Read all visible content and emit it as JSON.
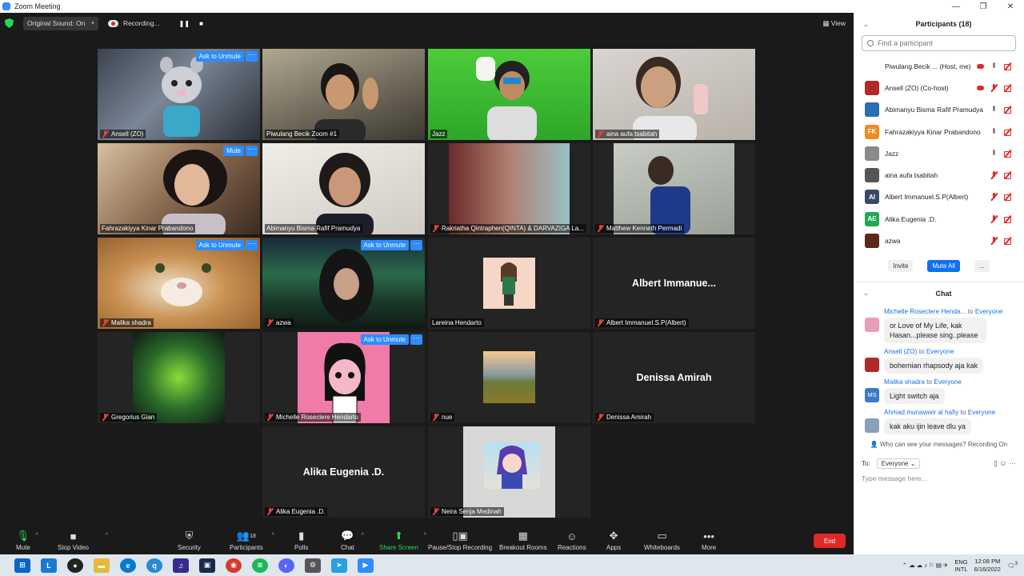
{
  "window": {
    "title": "Zoom Meeting",
    "controls": [
      "—",
      "❐",
      "✕"
    ]
  },
  "topbar": {
    "audio_label": "Original Sound: On",
    "recording_label": "Recording...",
    "pause_glyph": "❚❚",
    "stop_glyph": "■",
    "view_label": "View"
  },
  "tiles": [
    {
      "name": "Ansell (ZO)",
      "muted": true,
      "badge": "Ask to Unmute",
      "more": "···"
    },
    {
      "name": "Piwulang Becik Zoom #1",
      "muted": false,
      "active": true
    },
    {
      "name": "Jazz",
      "muted": false
    },
    {
      "name": "aina aufa tsabitah",
      "muted": true
    },
    {
      "name": "Fahrazakiyya Kinar Prabandono",
      "muted": false,
      "badge": "Mute",
      "more": "···"
    },
    {
      "name": "Abimanyu Bisma Rafif Pramudya",
      "muted": false
    },
    {
      "name": "Rakriatha Qintraphen(QINTA) & DARVAZIGA La...",
      "muted": true
    },
    {
      "name": "Matthew Kenneth Permadi",
      "muted": true
    },
    {
      "name": "Malika shadra",
      "muted": true,
      "badge": "Ask to Unmute",
      "more": "···"
    },
    {
      "name": "azwa",
      "muted": true,
      "badge": "Ask to Unmute",
      "more": "···"
    },
    {
      "name": "Lareina Hendarto",
      "muted": false
    },
    {
      "name": "Albert Immanuel.S.P(Albert)",
      "muted": true,
      "big": "Albert  Immanue..."
    },
    {
      "name": "Gregorius Gian",
      "muted": true
    },
    {
      "name": "Michelle Roseclere Hendarto",
      "muted": true,
      "badge": "Ask to Unmute",
      "more": "···"
    },
    {
      "name": "nue",
      "muted": true
    },
    {
      "name": "Denissa Amirah",
      "muted": true,
      "big": "Denissa Amirah"
    },
    {
      "name": "Alika Eugenia .D.",
      "muted": true,
      "big": "Alika Eugenia .D."
    },
    {
      "name": "Neira Senja Medinah",
      "muted": true
    }
  ],
  "toolbar": {
    "mute": "Mute",
    "stop_video": "Stop Video",
    "security": "Security",
    "participants": "Participants",
    "participants_count": "18",
    "polls": "Polls",
    "chat": "Chat",
    "share_screen": "Share Screen",
    "pause_recording": "Pause/Stop Recording",
    "breakout_rooms": "Breakout Rooms",
    "reactions": "Reactions",
    "apps": "Apps",
    "whiteboards": "Whiteboards",
    "more": "More",
    "end": "End"
  },
  "participants_panel": {
    "title": "Participants (18)",
    "search_placeholder": "Find a participant",
    "items": [
      {
        "name": "Piwulang Becik ...   (Host, me)",
        "avatar_color": "#ffffff",
        "initials": "",
        "icons": [
          "rec",
          "mic",
          "cam"
        ]
      },
      {
        "name": "Ansell (ZO) (Co-host)",
        "avatar_color": "#b02a2a",
        "initials": "",
        "icons": [
          "rec",
          "micx",
          "cam"
        ]
      },
      {
        "name": "Abimanyu Bisma Rafif Pramudya",
        "avatar_color": "#2a6fb0",
        "initials": "",
        "icons": [
          "mic",
          "cam"
        ]
      },
      {
        "name": "Fahrazakiyya Kinar Prabandono",
        "avatar_color": "#f08a24",
        "initials": "FK",
        "icons": [
          "mic",
          "cam"
        ]
      },
      {
        "name": "Jazz",
        "avatar_color": "#8a8a8a",
        "initials": "",
        "icons": [
          "mic",
          "cam"
        ]
      },
      {
        "name": "aina aufa tsabitah",
        "avatar_color": "#555555",
        "initials": "",
        "icons": [
          "micx",
          "cam"
        ]
      },
      {
        "name": "Albert Immanuel.S.P(Albert)",
        "avatar_color": "#3a4a66",
        "initials": "AI",
        "icons": [
          "micx",
          "cam"
        ]
      },
      {
        "name": "Alika Eugenia .D.",
        "avatar_color": "#23a85a",
        "initials": "AE",
        "icons": [
          "micx",
          "cam"
        ]
      },
      {
        "name": "azwa",
        "avatar_color": "#5a2a1a",
        "initials": "",
        "icons": [
          "micx",
          "cam"
        ]
      }
    ],
    "invite": "Invite",
    "mute_all": "Mute All",
    "more": "..."
  },
  "chat": {
    "title": "Chat",
    "messages": [
      {
        "from": "Michelle Roseclere Henda...",
        "to_word": "to",
        "to": "Everyone",
        "text": "or Love of My Life, kak Hasan...please sing..please",
        "avatar_color": "#e8a0b8",
        "initials": ""
      },
      {
        "from": "Ansell (ZO)",
        "to_word": "to",
        "to": "Everyone",
        "text": "bohemian rhapsody aja kak",
        "avatar_color": "#b02a2a",
        "initials": ""
      },
      {
        "from": "Malika shadra",
        "to_word": "to",
        "to": "Everyone",
        "text": "Light switch aja",
        "avatar_color": "#3a7ac8",
        "initials": "MS"
      },
      {
        "from": "Ahmad munawwir al hafiy",
        "to_word": "to",
        "to": "Everyone",
        "text": "kak aku ijin leave dlu ya",
        "avatar_color": "#8aa0b8",
        "initials": ""
      }
    ],
    "who_can_see": "Who can see your messages? Recording On",
    "to_label": "To:",
    "to_value": "Everyone ⌄",
    "input_placeholder": "Type message here..."
  },
  "taskbar": {
    "lang_top": "ENG",
    "lang_bottom": "INTL",
    "time": "12:08 PM",
    "date": "6/16/2022",
    "notif": "3"
  },
  "colors": {
    "accent": "#2d8cff",
    "end": "#e02828",
    "share": "#23d959",
    "active_speaker": "#f0ea5c"
  }
}
